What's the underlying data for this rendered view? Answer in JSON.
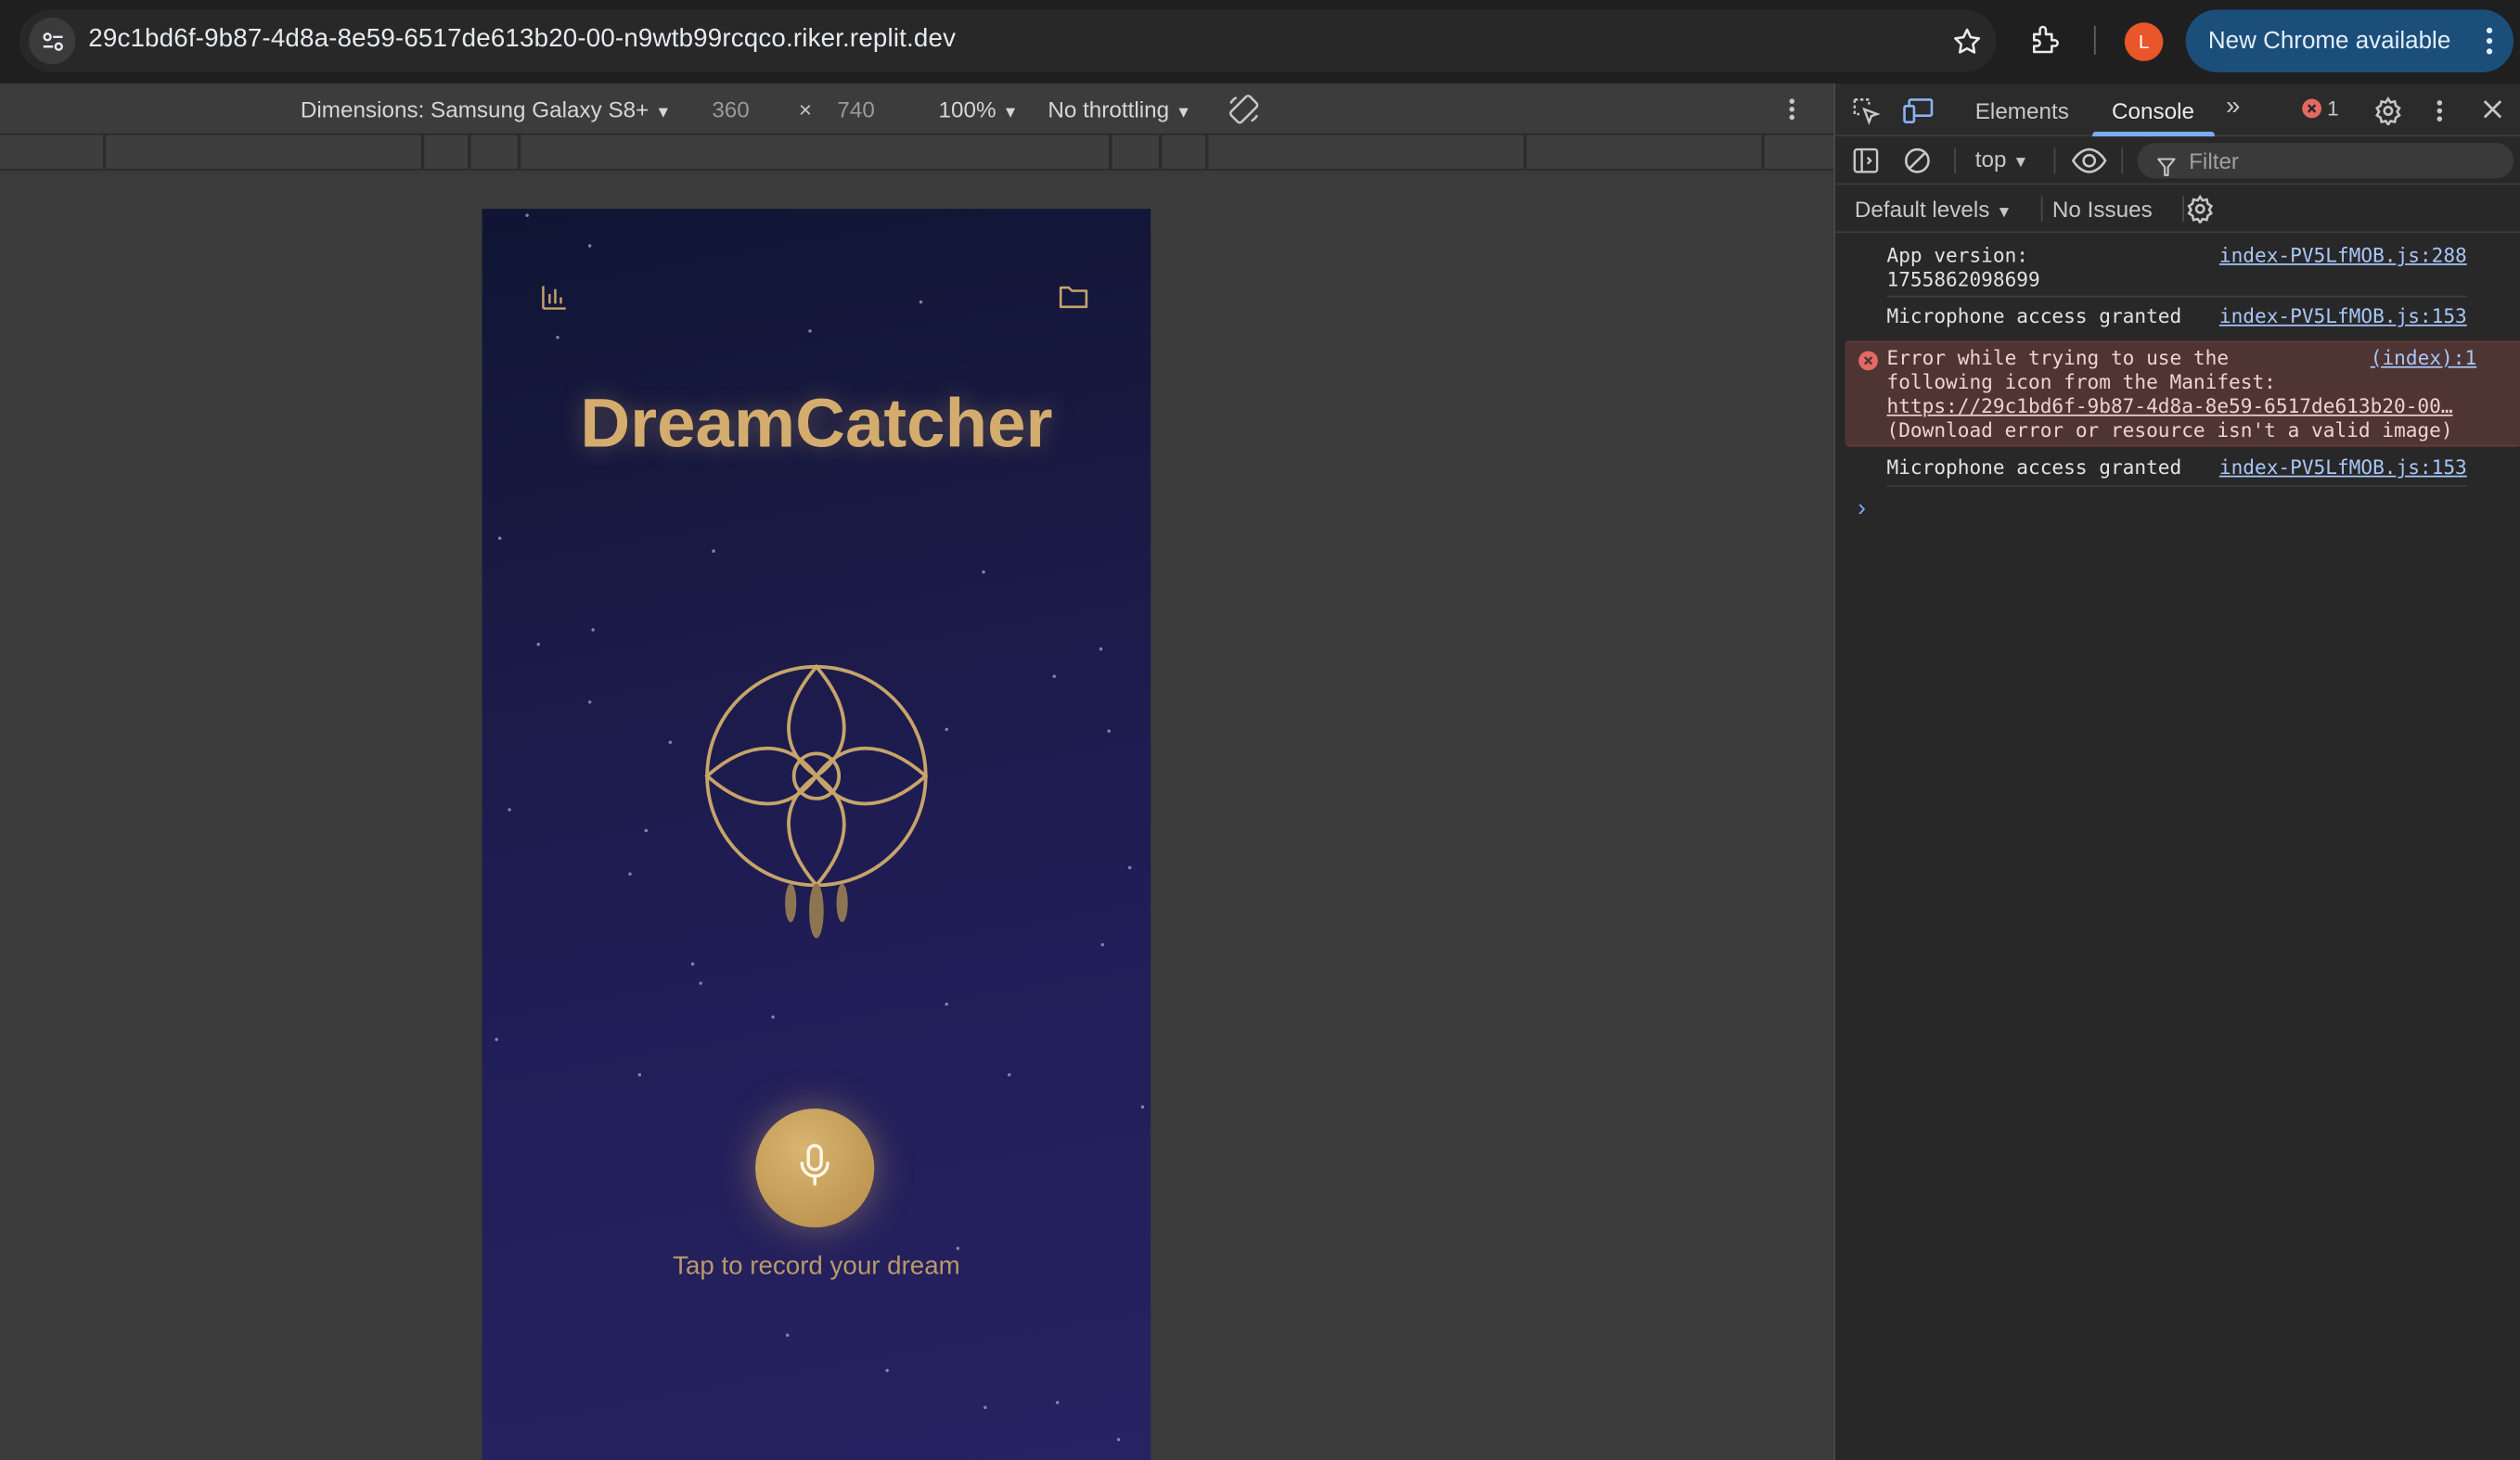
{
  "browser": {
    "url": "29c1bd6f-9b87-4d8a-8e59-6517de613b20-00-n9wtb99rcqco.riker.replit.dev",
    "profile_initial": "L",
    "update_button": "New Chrome available"
  },
  "device_toolbar": {
    "dimensions_label": "Dimensions: Samsung Galaxy S8+",
    "width": "360",
    "times": "×",
    "height": "740",
    "zoom": "100%",
    "throttling": "No throttling"
  },
  "app": {
    "title": "DreamCatcher",
    "record_hint": "Tap to record your dream",
    "accent": "#d4ad6e"
  },
  "devtools": {
    "tabs": [
      "Elements",
      "Console"
    ],
    "active_tab": "Console",
    "error_count": "1",
    "context": "top",
    "filter_placeholder": "Filter",
    "levels": "Default levels",
    "issues": "No Issues",
    "messages": [
      {
        "line1": "App version:",
        "line2": "1755862098699",
        "source": "index-PV5LfMOB.js:288"
      },
      {
        "line1": "Microphone access granted",
        "source": "index-PV5LfMOB.js:153"
      },
      {
        "line1": "Error while trying to use the",
        "line2": "following icon from the Manifest:",
        "link": "https://29c1bd6f-9b87-4d8a-8e59-6517de613b20-00…",
        "line4": "(Download error or resource isn't a valid image)",
        "source": "(index):1"
      },
      {
        "line1": "Microphone access granted",
        "source": "index-PV5LfMOB.js:153"
      }
    ]
  }
}
